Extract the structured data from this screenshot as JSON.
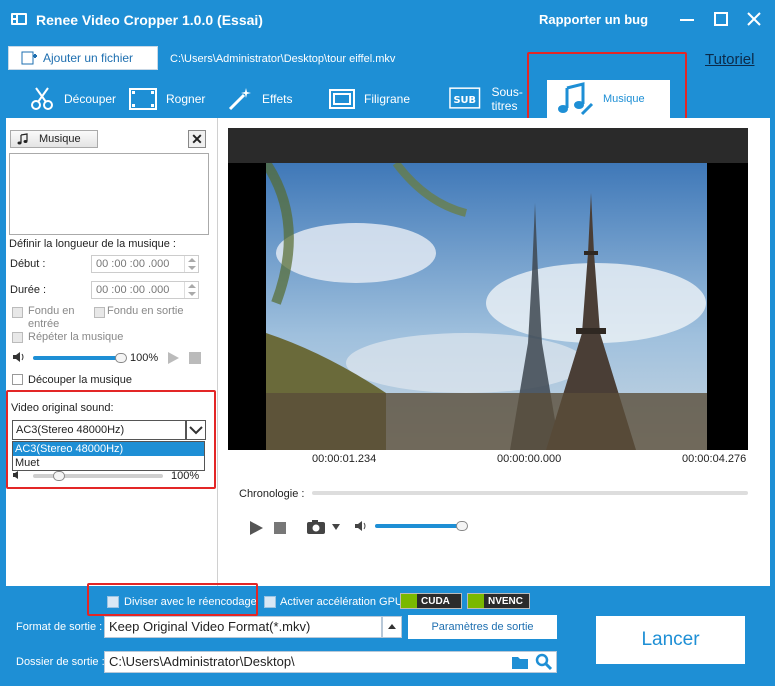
{
  "titlebar": {
    "title": "Renee Video Cropper 1.0.0 (Essai)",
    "bug_link": "Rapporter un bug"
  },
  "file": {
    "add_button": "Ajouter un fichier",
    "path": "C:\\Users\\Administrator\\Desktop\\tour eiffel.mkv",
    "tutorial": "Tutoriel"
  },
  "tabs": [
    {
      "label": "Découper",
      "icon": "scissors-icon"
    },
    {
      "label": "Rogner",
      "icon": "film-crop-icon"
    },
    {
      "label": "Effets",
      "icon": "magic-wand-icon"
    },
    {
      "label": "Filigrane",
      "icon": "watermark-icon"
    },
    {
      "label": "Sous-titres",
      "icon": "subtitle-icon"
    },
    {
      "label": "Musique",
      "icon": "music-note-icon",
      "active": true
    }
  ],
  "music_panel": {
    "add_button": "Musique",
    "close_symbol": "✕",
    "length_label": "Définir la longueur de la musique :",
    "start_label": "Début :",
    "start_value": "00 :00 :00 .000",
    "duration_label": "Durée :",
    "duration_value": "00 :00 :00 .000",
    "fade_in": "Fondu en entrée",
    "fade_out": "Fondu en sortie",
    "repeat": "Répéter la musique",
    "volume_percent": "100%",
    "volume_level": 1.0,
    "cut_music": "Découper la musique",
    "original_sound_label": "Video original sound:",
    "original_sound_selected": "AC3(Stereo 48000Hz)",
    "original_sound_options": [
      "AC3(Stereo 48000Hz)",
      "Muet"
    ],
    "original_volume_percent": "100%",
    "original_volume_level": 0.2
  },
  "video": {
    "time_left": "00:00:01.234",
    "time_center": "00:00:00.000",
    "time_right": "00:00:04.276",
    "chronologie_label": "Chronologie :",
    "player_volume_level": 1.0
  },
  "bottom": {
    "reencode": "Diviser avec le réencodage",
    "gpu_accel": "Activer accélération GPU",
    "cuda": "CUDA",
    "nvenc": "NVENC",
    "format_label": "Format de sortie :",
    "format_value": "Keep Original Video Format(*.mkv)",
    "params_button": "Paramètres de sortie",
    "folder_label": "Dossier de sortie :",
    "folder_value": "C:\\Users\\Administrator\\Desktop\\",
    "launch_button": "Lancer"
  },
  "colors": {
    "accent": "#1e8fd5",
    "highlight_box": "#e32626"
  }
}
